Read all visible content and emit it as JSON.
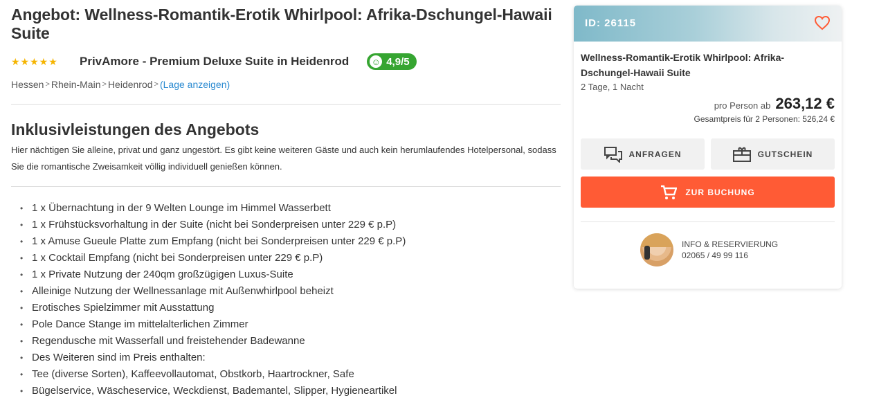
{
  "offer": {
    "title": "Angebot: Wellness-Romantik-Erotik Whirlpool: Afrika-Dschungel-Hawaii Suite",
    "stars": "★★★★★",
    "hotel_name": "PrivAmore - Premium Deluxe Suite in Heidenrod",
    "rating": "4,9/5",
    "breadcrumb": [
      "Hessen",
      "Rhein-Main",
      "Heidenrod"
    ],
    "location_link": "(Lage anzeigen)"
  },
  "inclusions": {
    "heading": "Inklusivleistungen des Angebots",
    "description": "Hier nächtigen Sie alleine, privat und ganz ungestört. Es gibt keine weiteren Gäste und auch kein herumlaufendes Hotelpersonal, sodass Sie die romantische Zweisamkeit völlig individuell genießen können.",
    "items": [
      "1 x Übernachtung in der 9 Welten Lounge im Himmel Wasserbett",
      "1 x Frühstücksvorhaltung in der Suite (nicht bei Sonderpreisen unter 229 € p.P)",
      "1 x Amuse Gueule Platte zum Empfang (nicht bei Sonderpreisen unter 229 € p.P)",
      "1 x Cocktail Empfang (nicht bei Sonderpreisen unter 229 € p.P)",
      "1 x Private Nutzung der 240qm großzügigen Luxus-Suite",
      "Alleinige Nutzung der Wellnessanlage mit Außenwhirlpool beheizt",
      "Erotisches Spielzimmer mit Ausstattung",
      "Pole Dance Stange im mittelalterlichen Zimmer",
      "Regendusche mit Wasserfall und freistehender Badewanne",
      "Des Weiteren sind im Preis enthalten:",
      "Tee (diverse Sorten), Kaffeevollautomat, Obstkorb, Haartrockner, Safe",
      "Bügelservice, Wäscheservice, Weckdienst, Bademantel, Slipper, Hygieneartikel"
    ]
  },
  "sidebar": {
    "id_label": "ID: 26115",
    "title": "Wellness-Romantik-Erotik Whirlpool: Afrika-Dschungel-Hawaii Suite",
    "duration": "2 Tage, 1 Nacht",
    "price_label": "pro Person ab",
    "price": "263,12 €",
    "total": "Gesamtpreis für 2 Personen: 526,24 €",
    "btn_inquire": "ANFRAGEN",
    "btn_voucher": "GUTSCHEIN",
    "btn_book": "ZUR BUCHUNG",
    "contact_label": "INFO & RESERVIERUNG",
    "contact_phone": "02065 / 49 99 116",
    "accent_color": "#ff5b35",
    "rating_color": "#36a531"
  }
}
